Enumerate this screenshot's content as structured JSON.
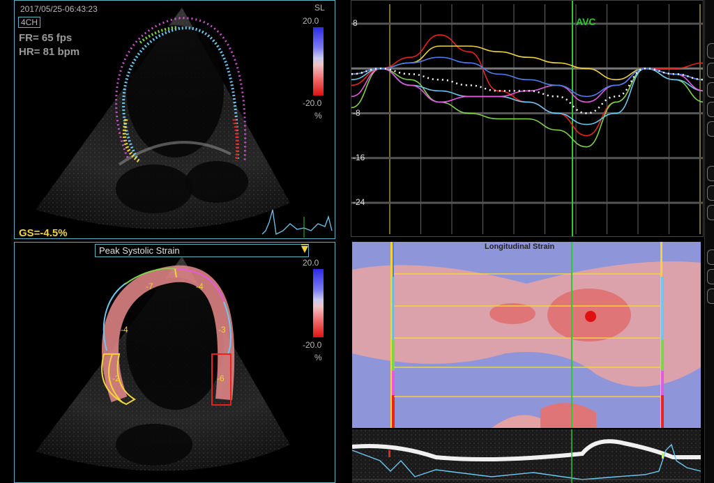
{
  "top_left": {
    "timestamp": "2017/05/25-06:43:23",
    "view_label": "4CH",
    "fr": "FR= 65 fps",
    "hr": "HR= 81 bpm",
    "sl_label": "SL",
    "scale_max": "20.0",
    "scale_min": "-20.0",
    "scale_unit": "%",
    "gs": "GS=-4.5%"
  },
  "bottom_left": {
    "dropdown_value": "Peak Systolic Strain",
    "scale_max": "20.0",
    "scale_min": "-20.0",
    "scale_unit": "%",
    "segment_values": [
      {
        "label": "-7",
        "color": "#7fd34a"
      },
      {
        "label": "-4",
        "color": "#e35be0"
      },
      {
        "label": "-4",
        "color": "#6cc8f0"
      },
      {
        "label": "-3",
        "color": "#6cc8f0"
      },
      {
        "label": "-2",
        "color": "#f2d43a"
      },
      {
        "label": "-6",
        "color": "#e8241c"
      }
    ]
  },
  "top_right": {
    "avc_label": "AVC",
    "y_labels": [
      "8",
      "-8",
      "-16",
      "-24"
    ]
  },
  "mid_right": {
    "title": "Longitudinal Strain"
  },
  "colors": {
    "panel_border": "#5fb3c7",
    "avc": "#2ec92e",
    "timeline": "#f2e24a",
    "seg_yellow": "#f2d43a",
    "seg_cyan": "#6cc8f0",
    "seg_green": "#7fd34a",
    "seg_magenta": "#e35be0",
    "seg_red": "#e8241c",
    "seg_blue": "#4d7be8"
  },
  "chart_data": {
    "type": "line",
    "ylim": [
      -24,
      8
    ],
    "y_ticks": [
      8,
      -8,
      -16,
      -24
    ],
    "x": [
      0,
      1,
      2,
      3,
      4,
      5,
      6,
      7,
      8,
      9,
      10,
      11,
      12
    ],
    "series": [
      {
        "color": "#e8241c",
        "values": [
          -3,
          0,
          2,
          6,
          3,
          -4,
          -6,
          -8,
          -12,
          -6,
          0,
          0,
          1
        ]
      },
      {
        "color": "#f2d43a",
        "values": [
          -1,
          0,
          1,
          4,
          4,
          3,
          2,
          1,
          0,
          -2,
          0,
          -1,
          -2
        ]
      },
      {
        "color": "#7fd34a",
        "values": [
          -7,
          0,
          -2,
          -6,
          -8,
          -9,
          -9,
          -11,
          -14,
          -6,
          0,
          -2,
          -6
        ]
      },
      {
        "color": "#6cc8f0",
        "values": [
          -2,
          0,
          -3,
          -4,
          -5,
          -5,
          -6,
          -8,
          -10,
          -8,
          0,
          -2,
          -4
        ]
      },
      {
        "color": "#e35be0",
        "values": [
          -5,
          0,
          -3,
          -6,
          -5,
          -5,
          -4,
          -3,
          -6,
          -3,
          0,
          -1,
          -4
        ]
      },
      {
        "color": "#4d7be8",
        "values": [
          -1,
          0,
          1,
          2,
          1,
          -1,
          -2,
          -3,
          -5,
          -3,
          0,
          -1,
          -2
        ]
      },
      {
        "color": "#ffffff",
        "dashed": true,
        "values": [
          -1,
          0,
          -1,
          -2,
          -3,
          -4,
          -4,
          -5,
          -8,
          -5,
          0,
          -1,
          -2
        ]
      }
    ]
  }
}
